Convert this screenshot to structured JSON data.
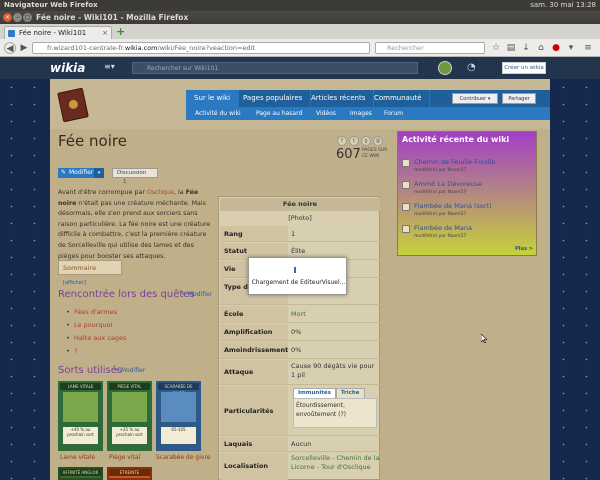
{
  "os_bar": {
    "app": "Navigateur Web Firefox",
    "datetime": "sam. 30 mai 13:28"
  },
  "window": {
    "title": "Fée noire - Wiki101 - Mozilla Firefox"
  },
  "tab": {
    "label": "Fée noire - Wiki101"
  },
  "url": {
    "prefix": "fr.wizard101-centrale-fr.",
    "domain": "wikia.com",
    "path": "/wiki/Fée_noire?veaction=edit"
  },
  "search": {
    "placeholder": "Rechercher"
  },
  "wikia": {
    "logo": "wikia",
    "search_placeholder": "Rechercher sur Wiki101",
    "create_label": "Créer un wikia"
  },
  "wiki_nav": {
    "tabs": [
      "Sur le wiki",
      "Pages populaires",
      "Articles récents",
      "Communauté"
    ],
    "sub": [
      "Activité du wiki",
      "Page au hasard",
      "Vidéos",
      "Images",
      "Forum"
    ],
    "contribute": "Contribuer ▾",
    "share": "Partager"
  },
  "page": {
    "title": "Fée noire",
    "page_count": "607",
    "page_count_label": "PAGES SUR CE WIKI",
    "edit_label": "Modifier",
    "discussion_label": "Discussion",
    "discussion_count": "1",
    "intro_p1": "Avant d'être corrompue par ",
    "intro_link": "Osclique",
    "intro_p2": ", la ",
    "intro_bold": "Fée noire",
    "intro_p3": " n'était pas une créature méchante. Mais désormais, elle s'en prend aux sorciers sans raison particulière. La fée noire est une créature difficile à combattre, c'est la première créature de Sorcelleville qui utilise des lames et des pièges pour booster ses attaques.",
    "summary_label": "Sommaire",
    "summary_show": "[afficher]"
  },
  "quests": {
    "heading": "Rencontrée lors des quêtes",
    "edit_label": "Modifier",
    "items": [
      "Fées d'armes",
      "Le pourquoi",
      "Halte aux cages",
      "?"
    ]
  },
  "spells": {
    "heading": "Sorts utilisés",
    "edit_label": "Modifier",
    "cards": [
      {
        "title": "LAME VITALE",
        "text": "+40 % au prochain sort",
        "label": "Lame vitale"
      },
      {
        "title": "PIÈGE VITAL",
        "text": "+25 % au prochain sort",
        "label": "Piège vital"
      },
      {
        "title": "SCARABÉE DE GIVRE",
        "text": "65-105",
        "label": "Scarabée de givre"
      }
    ],
    "row2_titles": [
      "AFFINITÉ ANGLOR",
      "ÉTREINTE"
    ]
  },
  "infobox": {
    "title": "Fée noire",
    "photo": "[Photo]",
    "rows": [
      {
        "key": "Rang",
        "value": "1"
      },
      {
        "key": "Statut",
        "value": "Élite"
      },
      {
        "key": "Vie",
        "value": ""
      },
      {
        "key": "Type de créature",
        "value": ""
      },
      {
        "key": "École",
        "value": "Mort"
      },
      {
        "key": "Amplification",
        "value": "0%"
      },
      {
        "key": "Amoindrissement",
        "value": "0%"
      },
      {
        "key": "Attaque naturelle",
        "value": "Cause 90 dégâts vie pour 1 pil"
      },
      {
        "key": "Particularités",
        "value": ""
      },
      {
        "key": "Laquais",
        "value": "Aucun"
      },
      {
        "key": "Localisation",
        "value": "Sorcelleville - Chemin de la Licorne - Tour d'Osclique"
      }
    ],
    "part_tabs": [
      "Immunités",
      "Triche"
    ],
    "part_text": "Étourdissement, envoûtement (?)"
  },
  "activity": {
    "heading": "Activité récente du wiki",
    "items": [
      {
        "title": "Chemin de Feuille-Fouille",
        "sub": "modifié(e) par Naxm57"
      },
      {
        "title": "Ammit La Dévoreuse",
        "sub": "modifié(e) par Naxm57"
      },
      {
        "title": "Flambée de Mana (sort)",
        "sub": "modifié(e) par Naxm57"
      },
      {
        "title": "Flambée de Mana",
        "sub": "modifié(e) par Naxm57"
      }
    ],
    "more": "Plus >"
  },
  "loading": {
    "text": "Chargement de EditeurVisuel..."
  },
  "colors": {
    "accent": "#2a79c1",
    "quest_heading": "#7c3e98",
    "wikia_header": "#22354d"
  }
}
